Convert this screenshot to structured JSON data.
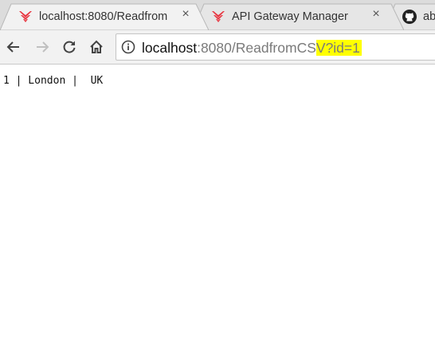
{
  "tabs": [
    {
      "title": "localhost:8080/Readfrom",
      "favicon": "api-gateway-icon",
      "close": "×",
      "active": true
    },
    {
      "title": "API Gateway Manager",
      "favicon": "api-gateway-icon",
      "close": "×",
      "active": false
    },
    {
      "title": "ab",
      "favicon": "github-icon",
      "active": false
    }
  ],
  "toolbar": {
    "url_host": "localhost",
    "url_path": ":8080/ReadfromCS",
    "url_query": "V?id=1"
  },
  "page": {
    "output": "1 | London |  UK"
  },
  "colors": {
    "favicon_red": "#e8343f",
    "highlight": "#ffff00"
  }
}
